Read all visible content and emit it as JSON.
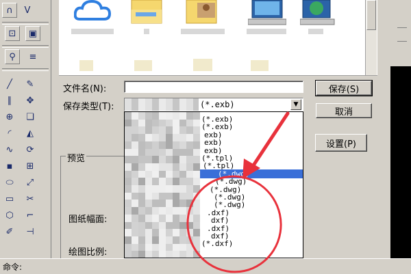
{
  "dialog": {
    "filename_label": "文件名(N):",
    "filename_value": "",
    "filetype_label": "保存类型(T):",
    "filetype_value": "(*.exb)",
    "save_button": "保存(S)",
    "cancel_button": "取消",
    "settings_button": "设置(P)",
    "preview_label": "预览",
    "paper_size_label": "图纸幅面:",
    "scale_label": "绘图比例:"
  },
  "dropdown": {
    "items": [
      {
        "text": "(*.exb)"
      },
      {
        "text": "(*.exb)"
      },
      {
        "text": "exb)"
      },
      {
        "text": "exb)"
      },
      {
        "text": "exb)"
      },
      {
        "text": "(*.tpl)"
      },
      {
        "text": "(*.tpl)"
      },
      {
        "text": "(*.dwg)",
        "selected": true
      },
      {
        "text": "(*.dwg)"
      },
      {
        "text": "(*.dwg)"
      },
      {
        "text": "(*.dwg)"
      },
      {
        "text": "(*.dwg)"
      },
      {
        "text": ".dxf)"
      },
      {
        "text": "dxf)"
      },
      {
        "text": ".dxf)"
      },
      {
        "text": "dxf)"
      },
      {
        "text": "(*.dxf)"
      }
    ]
  },
  "statusbar": {
    "command_label": "命令:"
  },
  "colors": {
    "selection": "#3a6fd8",
    "annotation": "#e8323c",
    "chrome": "#d4d0c8"
  },
  "icons": [
    "cloud-icon",
    "folder-icon",
    "folder-icon",
    "computer-icon",
    "network-globe-icon"
  ]
}
